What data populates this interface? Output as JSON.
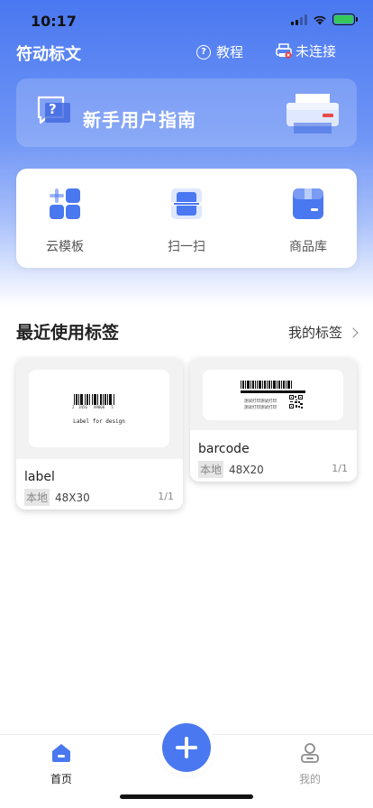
{
  "status": {
    "time": "10:17"
  },
  "header": {
    "title": "符动标文",
    "tutorial": "教程",
    "connection": "未连接"
  },
  "guide": {
    "text": "新手用户指南"
  },
  "quick_actions": [
    {
      "label": "云模板",
      "icon": "cloud-template-icon"
    },
    {
      "label": "扫一扫",
      "icon": "scan-icon"
    },
    {
      "label": "商品库",
      "icon": "product-library-icon"
    }
  ],
  "recent": {
    "title": "最近使用标签",
    "my_labels": "我的标签",
    "cards": [
      {
        "name": "label",
        "tag": "本地",
        "size": "48X30",
        "page": "1/1",
        "preview_text": "Label for design",
        "barcode_digits": "2  3456   89000   5"
      },
      {
        "name": "barcode",
        "tag": "本地",
        "size": "48X20",
        "page": "1/1",
        "preview_line1": "测试打印测试打印",
        "preview_line2": "测试打印测试打印"
      }
    ]
  },
  "nav": {
    "home": "首页",
    "mine": "我的"
  },
  "colors": {
    "primary": "#4a78f0",
    "accent": "#5b82f2"
  }
}
